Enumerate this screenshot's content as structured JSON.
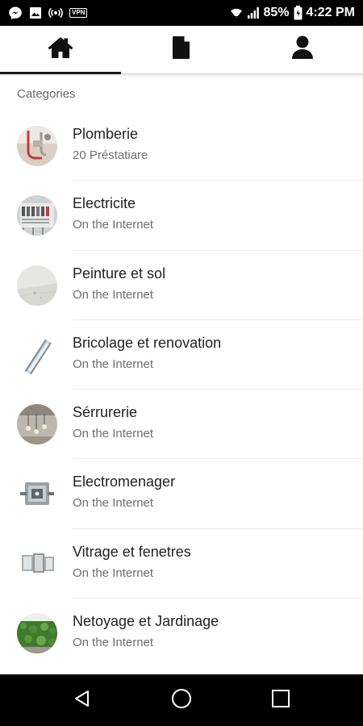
{
  "status_bar": {
    "battery": "85%",
    "time": "4:22 PM",
    "vpn_label": "VPN",
    "icons": [
      "messenger-icon",
      "image-icon",
      "hotspot-icon",
      "vpn-icon",
      "wifi-icon",
      "signal-icon",
      "battery-icon"
    ]
  },
  "tabs": [
    {
      "icon": "home-icon",
      "active": true
    },
    {
      "icon": "document-icon",
      "active": false
    },
    {
      "icon": "person-icon",
      "active": false
    }
  ],
  "section_title": "Categories",
  "categories": [
    {
      "title": "Plomberie",
      "subtitle": "20 Préstatiare"
    },
    {
      "title": "Electricite",
      "subtitle": "On the Internet"
    },
    {
      "title": "Peinture et sol",
      "subtitle": "On the Internet"
    },
    {
      "title": "Bricolage et renovation",
      "subtitle": "On the Internet"
    },
    {
      "title": "Sérrurerie",
      "subtitle": "On the Internet"
    },
    {
      "title": "Electromenager",
      "subtitle": "On the Internet"
    },
    {
      "title": "Vitrage et fenetres",
      "subtitle": "On the Internet"
    },
    {
      "title": "Netoyage et Jardinage",
      "subtitle": "On the Internet"
    }
  ],
  "nav_bar": [
    "back-icon",
    "home-circle-icon",
    "recents-icon"
  ]
}
